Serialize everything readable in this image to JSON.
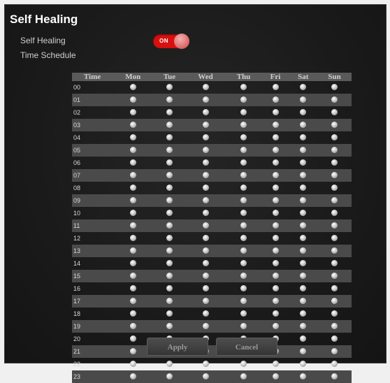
{
  "page": {
    "title": "Self Healing",
    "self_healing_label": "Self Healing",
    "time_schedule_label": "Time Schedule"
  },
  "toggle": {
    "state": "ON",
    "color": "#d81010"
  },
  "schedule": {
    "columns": [
      "Time",
      "Mon",
      "Tue",
      "Wed",
      "Thu",
      "Fri",
      "Sat",
      "Sun"
    ],
    "hours": [
      "00",
      "01",
      "02",
      "03",
      "04",
      "05",
      "06",
      "07",
      "08",
      "09",
      "10",
      "11",
      "12",
      "13",
      "14",
      "15",
      "16",
      "17",
      "18",
      "19",
      "20",
      "21",
      "22",
      "23"
    ],
    "slot_state": "off"
  },
  "buttons": {
    "apply": "Apply",
    "cancel": "Cancel"
  }
}
